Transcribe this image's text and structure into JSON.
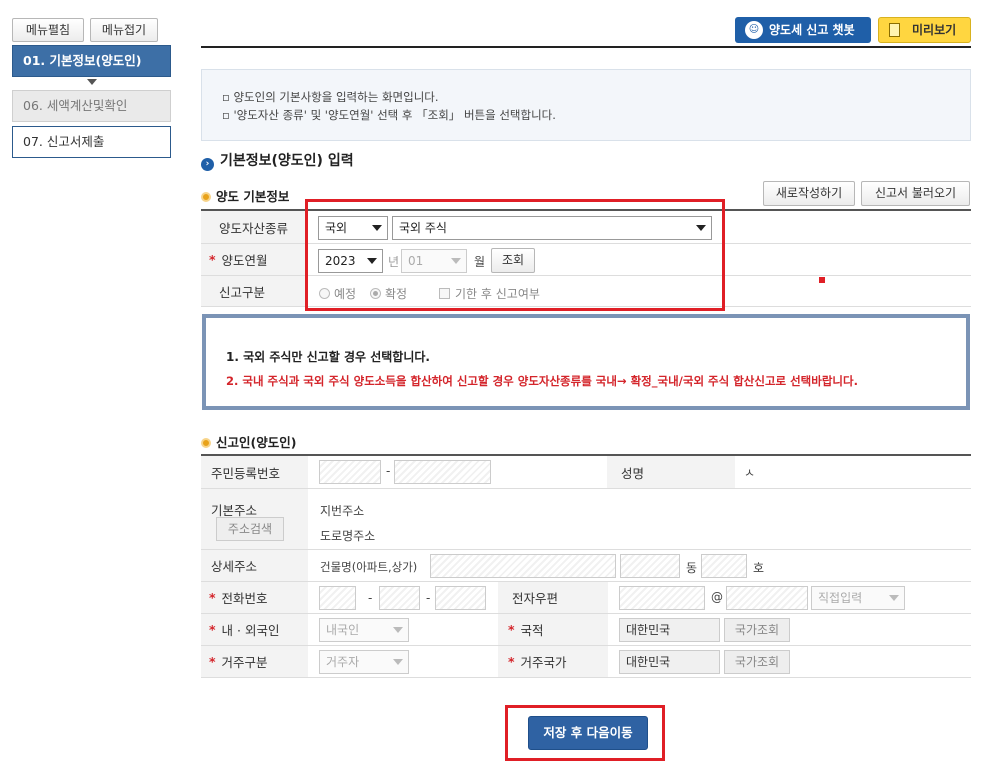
{
  "sidebar": {
    "expand_label": "메뉴펼침",
    "collapse_label": "메뉴접기",
    "items": [
      {
        "label": "01. 기본정보(양도인)",
        "state": "active"
      },
      {
        "label": "06. 세액계산및확인",
        "state": "disabled"
      },
      {
        "label": "07. 신고서제출",
        "state": "normal"
      }
    ]
  },
  "toolbar": {
    "chatbot_label": "양도세 신고 챗봇",
    "preview_label": "미리보기"
  },
  "info": {
    "line1": "▫ 양도인의 기본사항을 입력하는 화면입니다.",
    "line2": "▫ '양도자산 종류' 및 '양도연월' 선택 후 「조회」 버튼을 선택합니다."
  },
  "section_title": "기본정보(양도인) 입력",
  "transfer": {
    "title": "양도 기본정보",
    "new_button": "새로작성하기",
    "load_button": "신고서 불러오기",
    "asset_type_label": "양도자산종류",
    "asset_type_value": "국외",
    "asset_subtype_value": "국외 주식",
    "month_label": "양도연월",
    "year_value": "2023",
    "year_unit": "년",
    "month_value": "01",
    "month_unit": "월",
    "lookup_button": "조회",
    "report_type_label": "신고구분",
    "option_scheduled": "예정",
    "option_confirmed": "확정",
    "option_late": "기한 후 신고여부"
  },
  "notice": {
    "line1": "1. 국외 주식만 신고할 경우 선택합니다.",
    "line2": "2. 국내 주식과 국외 주식 양도소득을 합산하여 신고할 경우 양도자산종류를 국내→ 확정_국내/국외 주식 합산신고로 선택바랍니다.",
    "line2_color": "#d4252b"
  },
  "reporter": {
    "title": "신고인(양도인)",
    "rrn_label": "주민등록번호",
    "rrn_dash": "-",
    "name_label": "성명",
    "name_value": "ㅅ",
    "address_label": "기본주소",
    "address_search_button": "주소검색",
    "lot_address_label": "지번주소",
    "road_address_label": "도로명주소",
    "detail_address_label": "상세주소",
    "building_label": "건물명(아파트,상가)",
    "dong_label": "동",
    "ho_label": "호",
    "phone_label": "전화번호",
    "phone_dash": "-",
    "email_label": "전자우편",
    "email_at": "@",
    "email_domain_placeholder": "직접입력",
    "nationality_type_label": "내 · 외국인",
    "nationality_type_value": "내국인",
    "nationality_label": "국적",
    "nationality_value": "대한민국",
    "country_lookup_button": "국가조회",
    "residency_label": "거주구분",
    "residency_value": "거주자",
    "residence_country_label": "거주국가",
    "residence_country_value": "대한민국"
  },
  "save_button": "저장 후 다음이동",
  "colors": {
    "primary": "#2f62a3",
    "highlight": "#e01f26",
    "notice_border": "#7b94b6"
  }
}
